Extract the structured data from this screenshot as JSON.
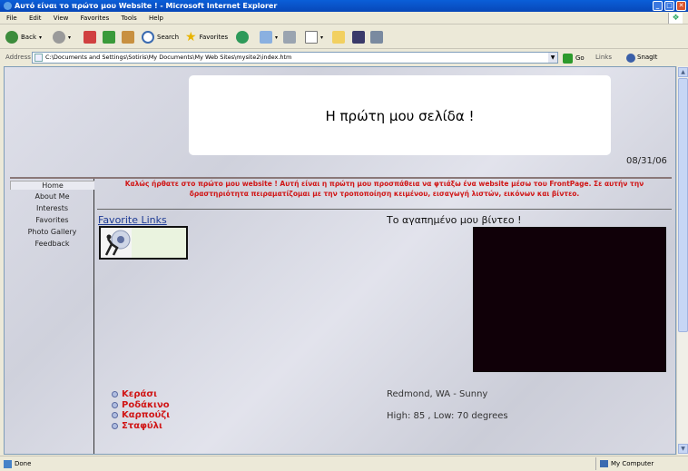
{
  "window": {
    "title": "Αυτό είναι το πρώτο μου Website ! - Microsoft Internet Explorer"
  },
  "menu": [
    "File",
    "Edit",
    "View",
    "Favorites",
    "Tools",
    "Help"
  ],
  "toolbar": {
    "back": "Back",
    "search": "Search",
    "favorites": "Favorites"
  },
  "address": {
    "label": "Address",
    "url": "C:\\Documents and Settings\\Sotiris\\My Documents\\My Web Sites\\mysite2\\index.htm",
    "go": "Go",
    "links": "Links",
    "snagit": "SnagIt"
  },
  "page": {
    "header_title": "Η πρώτη μου σελίδα !",
    "date": "08/31/06",
    "nav": [
      "Home",
      "About Me",
      "Interests",
      "Favorites",
      "Photo Gallery",
      "Feedback"
    ],
    "welcome": "Καλώς ήρθατε στο πρώτο μου website ! Αυτή είναι η πρώτη μου προσπάθεια να φτιάξω ένα website μέσω του FrontPage. Σε αυτήν την δραστηριότητα πειραματίζομαι με την τροποποίηση κειμένου, εισαγωγή λιστών, εικόνων και βίντεο.",
    "favorite_links": "Favorite Links",
    "video_title": "Το αγαπημένο μου βίντεο !",
    "fruits": [
      "Κεράσι",
      "Ροδάκινο",
      "Καρπούζι",
      "Σταφύλι"
    ],
    "weather_location": "Redmond, WA - Sunny",
    "weather_temps": "High: 85 , Low: 70 degrees"
  },
  "status": {
    "left": "Done",
    "zone": "My Computer"
  }
}
